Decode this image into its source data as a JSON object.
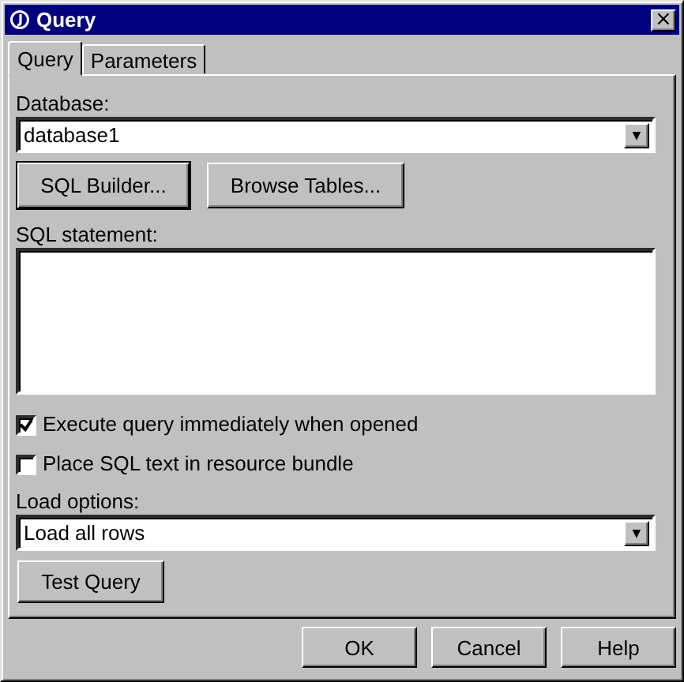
{
  "window": {
    "title": "Query",
    "close": "×"
  },
  "tabs": [
    {
      "label": "Query",
      "selected": true
    },
    {
      "label": "Parameters",
      "selected": false
    }
  ],
  "database": {
    "label": "Database:",
    "value": "database1",
    "arrow": "▼"
  },
  "query_buttons": [
    "SQL Builder...",
    "Browse Tables..."
  ],
  "sql": {
    "label": "SQL statement:"
  },
  "options": [
    {
      "label": "Execute query immediately when opened",
      "checked": true
    },
    {
      "label": "Place SQL text in resource bundle",
      "checked": false
    }
  ],
  "load": {
    "label": "Load options:",
    "value": "Load all rows",
    "arrow": "▼"
  },
  "test_button": "Test Query",
  "buttons": [
    "OK",
    "Cancel",
    "Help"
  ]
}
